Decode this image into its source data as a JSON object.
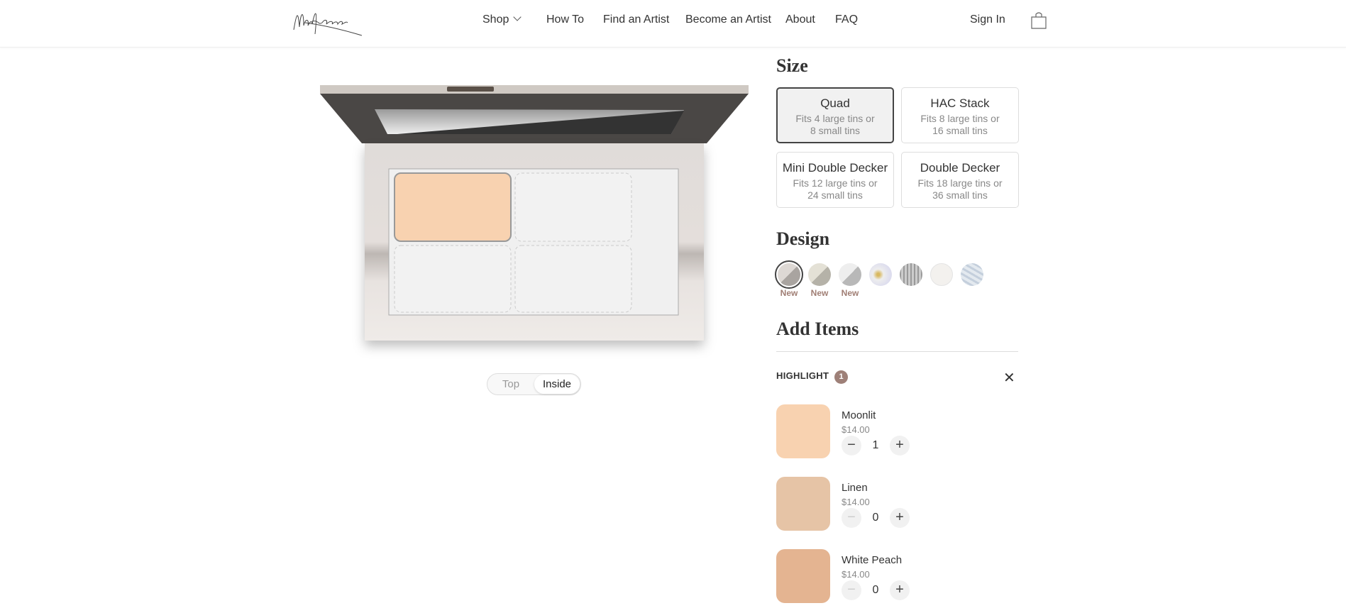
{
  "brand": {
    "logo_text": "Masqcara"
  },
  "nav": {
    "items": [
      "Shop",
      "How To",
      "Find an Artist",
      "Become an Artist",
      "About",
      "FAQ"
    ],
    "sign_in": "Sign In"
  },
  "size": {
    "heading": "Size",
    "options": [
      {
        "title": "Quad",
        "desc1": "Fits 4 large tins or",
        "desc2": "8 small tins",
        "selected": true
      },
      {
        "title": "HAC Stack",
        "desc1": "Fits 8 large tins or",
        "desc2": "16 small tins"
      },
      {
        "title": "Mini Double Decker",
        "desc1": "Fits 12 large tins or",
        "desc2": "24 small tins"
      },
      {
        "title": "Double Decker",
        "desc1": "Fits 18 large tins or",
        "desc2": "36 small tins"
      }
    ]
  },
  "design": {
    "heading": "Design",
    "new_label": "New",
    "swatch_count": 7,
    "selected_index": 0
  },
  "add_items": {
    "heading": "Add Items",
    "category": "HIGHLIGHT",
    "count": "1",
    "items": [
      {
        "name": "Moonlit",
        "price": "$14.00",
        "qty": "1",
        "color": "#f8d2b0"
      },
      {
        "name": "Linen",
        "price": "$14.00",
        "qty": "0",
        "color": "#e6c4a6"
      },
      {
        "name": "White Peach",
        "price": "$14.00",
        "qty": "0",
        "color": "#e4b491"
      }
    ]
  },
  "view_toggle": {
    "top": "Top",
    "inside": "Inside",
    "active": "Inside"
  },
  "palette": {
    "filled_slot_color": "#f8d2b0"
  }
}
